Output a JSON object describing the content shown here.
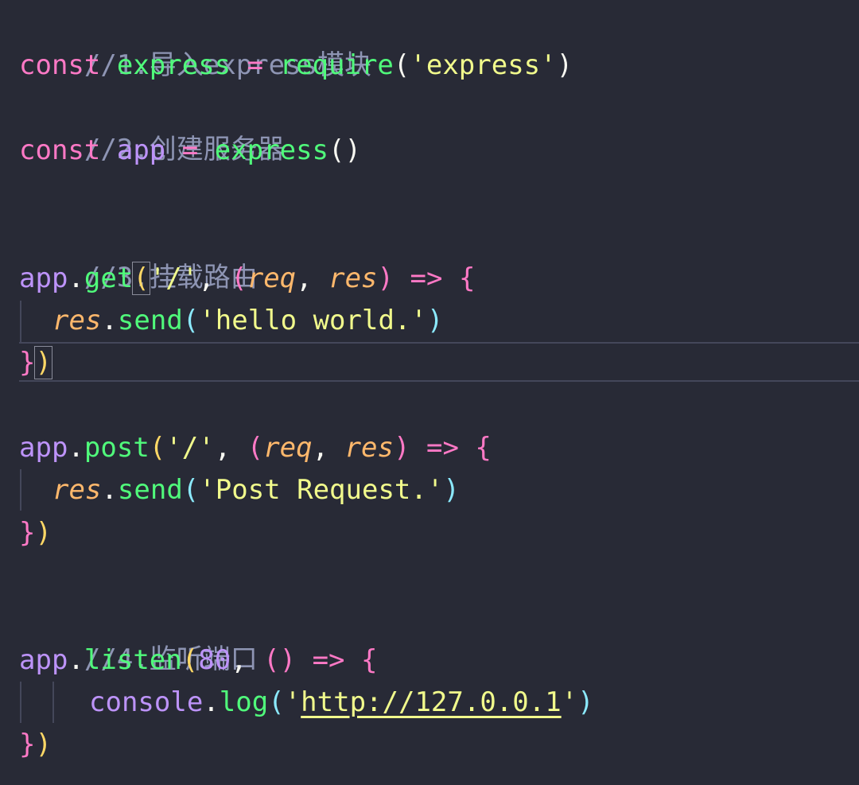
{
  "editor": {
    "lines": {
      "l1": {
        "comment": "//1.导入express模块"
      },
      "l2": {
        "kw": "const",
        "name": "express",
        "eq": "=",
        "fn": "require",
        "open": "(",
        "q1": "'",
        "str": "express",
        "q2": "'",
        "close": ")"
      },
      "l3": {
        "comment": "//2.创建服务器"
      },
      "l4": {
        "kw": "const",
        "name": "app",
        "eq": "=",
        "fn": "express",
        "parens": "()"
      },
      "l6": {
        "comment": "//3.挂载路由"
      },
      "l7": {
        "obj": "app",
        "dot": ".",
        "method": "get",
        "open": "(",
        "q1": "'",
        "str": "/",
        "q2": "'",
        "comma": ",",
        "popen": "(",
        "p1": "req",
        "pcomma": ",",
        "p2": "res",
        "pclose": ")",
        "arrow": "=>",
        "brace": "{"
      },
      "l8": {
        "obj": "res",
        "dot": ".",
        "method": "send",
        "open": "(",
        "q1": "'",
        "str": "hello world.",
        "q2": "'",
        "close": ")"
      },
      "l9": {
        "brace": "}",
        "close": ")"
      },
      "l11": {
        "obj": "app",
        "dot": ".",
        "method": "post",
        "open": "(",
        "q1": "'",
        "str": "/",
        "q2": "'",
        "comma": ",",
        "popen": "(",
        "p1": "req",
        "pcomma": ",",
        "p2": "res",
        "pclose": ")",
        "arrow": "=>",
        "brace": "{"
      },
      "l12": {
        "obj": "res",
        "dot": ".",
        "method": "send",
        "open": "(",
        "q1": "'",
        "str": "Post Request.",
        "q2": "'",
        "close": ")"
      },
      "l13": {
        "brace": "}",
        "close": ")"
      },
      "l15": {
        "comment": "//4.监听端口"
      },
      "l16": {
        "obj": "app",
        "dot": ".",
        "method": "listen",
        "open": "(",
        "num": "80",
        "comma": ",",
        "parens": "()",
        "arrow": "=>",
        "brace": "{"
      },
      "l17": {
        "obj": "console",
        "dot": ".",
        "method": "log",
        "open": "(",
        "q1": "'",
        "str": "http://127.0.0.1",
        "q2": "'",
        "close": ")"
      },
      "l18": {
        "brace": "}",
        "close": ")"
      }
    }
  }
}
